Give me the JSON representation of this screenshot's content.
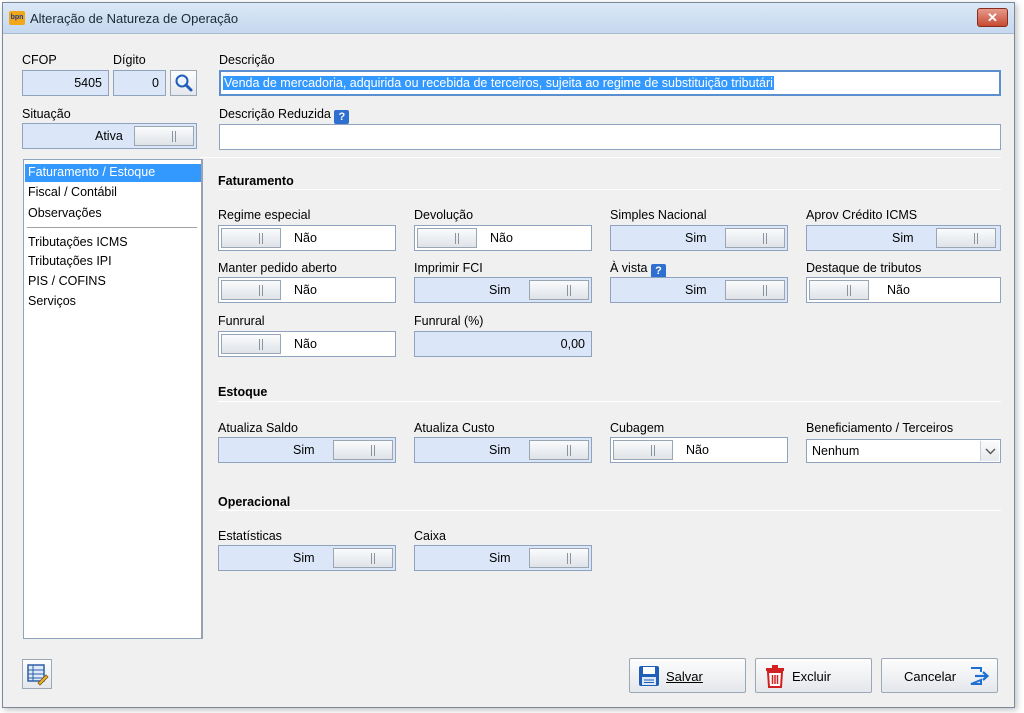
{
  "window": {
    "title": "Alteração de Natureza de Operação",
    "close_symbol": "✕",
    "app_icon_text": "bpn"
  },
  "header": {
    "cfop_label": "CFOP",
    "cfop_value": "5405",
    "digito_label": "Dígito",
    "digito_value": "0",
    "descricao_label": "Descrição",
    "descricao_value": "Venda de mercadoria, adquirida ou recebida de terceiros, sujeita ao regime de substituição tributári",
    "situacao_label": "Situação",
    "situacao_value": "Ativa",
    "descricao_reduzida_label": "Descrição Reduzida",
    "descricao_reduzida_value": "",
    "help_symbol": "?"
  },
  "sidebar": {
    "items": [
      {
        "label": "Faturamento / Estoque"
      },
      {
        "label": "Fiscal / Contábil"
      },
      {
        "label": "Observações"
      },
      {
        "label": "Tributações ICMS"
      },
      {
        "label": "Tributações IPI"
      },
      {
        "label": "PIS / COFINS"
      },
      {
        "label": "Serviços"
      }
    ],
    "selected": "Faturamento / Estoque"
  },
  "faturamento": {
    "title": "Faturamento",
    "regime_especial": {
      "label": "Regime especial",
      "value": "Não"
    },
    "devolucao": {
      "label": "Devolução",
      "value": "Não"
    },
    "simples_nacional": {
      "label": "Simples Nacional",
      "value": "Sim"
    },
    "aprov_credito_icms": {
      "label": "Aprov Crédito ICMS",
      "value": "Sim"
    },
    "manter_pedido_aberto": {
      "label": "Manter pedido aberto",
      "value": "Não"
    },
    "imprimir_fci": {
      "label": "Imprimir FCI",
      "value": "Sim"
    },
    "a_vista": {
      "label": "À vista",
      "value": "Sim"
    },
    "destaque_tributos": {
      "label": "Destaque de tributos",
      "value": "Não"
    },
    "funrural": {
      "label": "Funrural",
      "value": "Não"
    },
    "funrural_pct": {
      "label": "Funrural (%)",
      "value": "0,00"
    }
  },
  "estoque": {
    "title": "Estoque",
    "atualiza_saldo": {
      "label": "Atualiza Saldo",
      "value": "Sim"
    },
    "atualiza_custo": {
      "label": "Atualiza Custo",
      "value": "Sim"
    },
    "cubagem": {
      "label": "Cubagem",
      "value": "Não"
    },
    "beneficiamento": {
      "label": "Beneficiamento / Terceiros",
      "value": "Nenhum"
    }
  },
  "operacional": {
    "title": "Operacional",
    "estatisticas": {
      "label": "Estatísticas",
      "value": "Sim"
    },
    "caixa": {
      "label": "Caixa",
      "value": "Sim"
    }
  },
  "footer": {
    "salvar_label": "Salvar",
    "excluir_label": "Excluir",
    "cancelar_label": "Cancelar"
  },
  "colors": {
    "selection": "#3399ff",
    "active_field": "#dbe7f8",
    "field_border": "#8fa3bd",
    "close": "#c74a31"
  }
}
